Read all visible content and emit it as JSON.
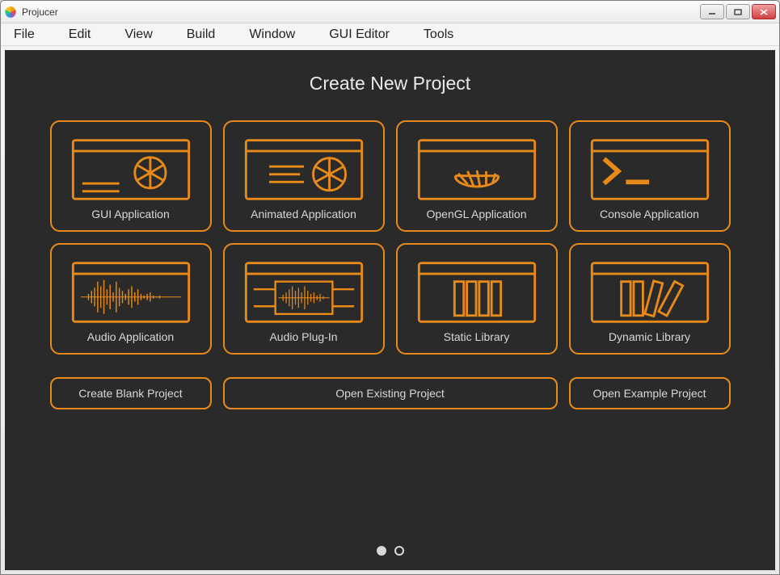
{
  "window": {
    "title": "Projucer"
  },
  "menu": {
    "items": [
      "File",
      "Edit",
      "View",
      "Build",
      "Window",
      "GUI Editor",
      "Tools"
    ]
  },
  "main": {
    "title": "Create New Project",
    "tiles": [
      {
        "label": "GUI Application"
      },
      {
        "label": "Animated Application"
      },
      {
        "label": "OpenGL Application"
      },
      {
        "label": "Console Application"
      },
      {
        "label": "Audio Application"
      },
      {
        "label": "Audio Plug-In"
      },
      {
        "label": "Static Library"
      },
      {
        "label": "Dynamic Library"
      }
    ],
    "actions": {
      "blank": "Create Blank Project",
      "open": "Open Existing Project",
      "example": "Open Example Project"
    }
  },
  "colors": {
    "accent": "#e88a1a",
    "bg": "#2a2a2a"
  }
}
